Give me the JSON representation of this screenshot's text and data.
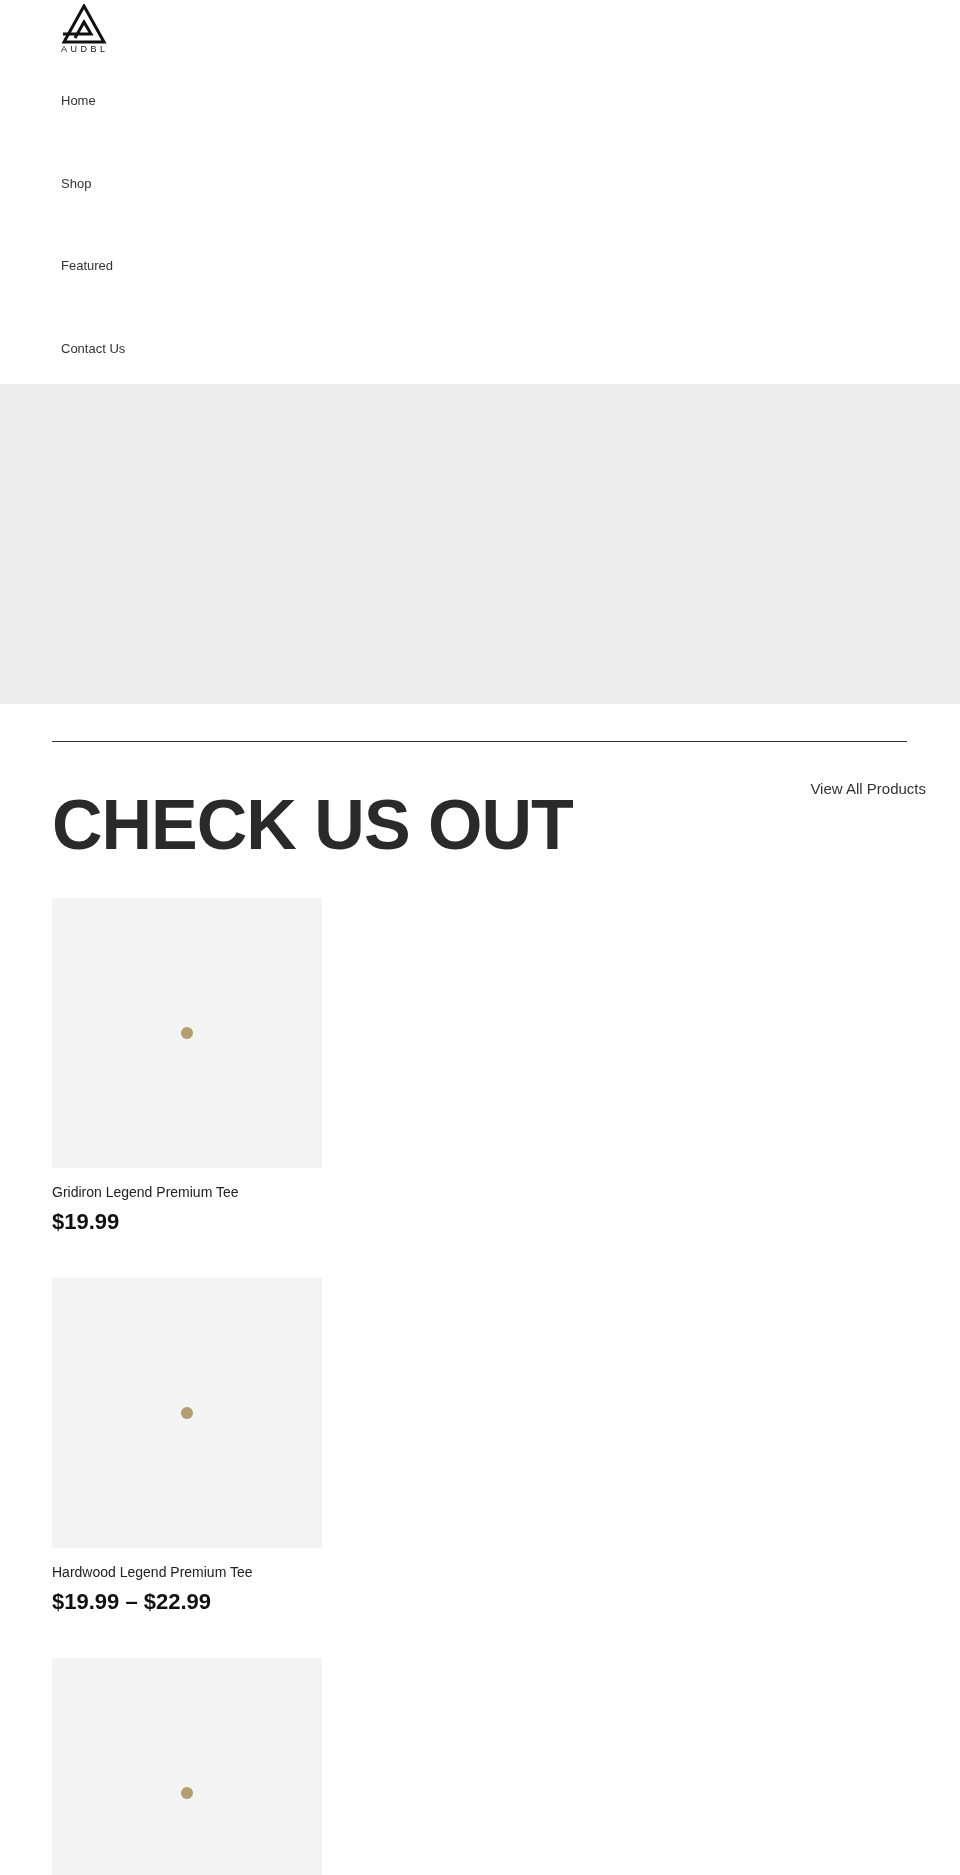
{
  "logo": {
    "text": "AUDBL"
  },
  "nav": [
    {
      "label": "Home"
    },
    {
      "label": "Shop"
    },
    {
      "label": "Featured"
    },
    {
      "label": "Contact Us"
    }
  ],
  "section": {
    "title": "CHECK US OUT",
    "link": "View All Products"
  },
  "products": [
    {
      "kind": "full",
      "name": "Gridiron Legend Premium Tee",
      "price": "$19.99"
    },
    {
      "kind": "full",
      "name": "Hardwood Legend Premium Tee",
      "price": "$19.99 – $22.99"
    },
    {
      "kind": "image_only"
    }
  ]
}
